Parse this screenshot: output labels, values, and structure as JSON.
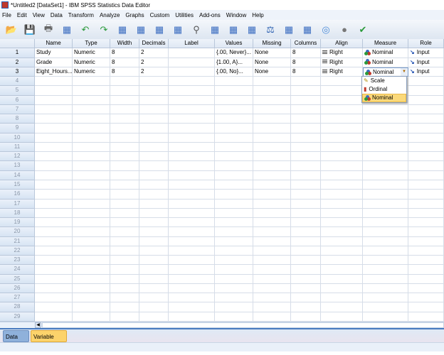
{
  "window": {
    "title": "*Untitled2 [DataSet1] - IBM SPSS Statistics Data Editor"
  },
  "menu": [
    "File",
    "Edit",
    "View",
    "Data",
    "Transform",
    "Analyze",
    "Graphs",
    "Custom",
    "Utilities",
    "Add-ons",
    "Window",
    "Help"
  ],
  "toolbar": [
    "open-icon",
    "save-icon",
    "print-icon",
    "recall-dialog-icon",
    "undo-icon",
    "redo-icon",
    "goto-case-icon",
    "goto-variable-icon",
    "variables-icon",
    "insert-variable-icon",
    "find-icon",
    "insert-cases-icon",
    "select-cases-icon",
    "split-file-icon",
    "weight-cases-icon",
    "value-labels-icon",
    "use-sets-icon",
    "show-all-variables-icon",
    "hide-icon",
    "spell-check-icon"
  ],
  "columns": [
    "Name",
    "Type",
    "Width",
    "Decimals",
    "Label",
    "Values",
    "Missing",
    "Columns",
    "Align",
    "Measure",
    "Role"
  ],
  "variables": [
    {
      "row": "1",
      "name": "Study",
      "type": "Numeric",
      "width": "8",
      "decimals": "2",
      "label": "",
      "values": "{.00, Never}...",
      "missing": "None",
      "columns": "8",
      "align": "Right",
      "measure": "Nominal",
      "role": "Input"
    },
    {
      "row": "2",
      "name": "Grade",
      "type": "Numeric",
      "width": "8",
      "decimals": "2",
      "label": "",
      "values": "{1.00, A}...",
      "missing": "None",
      "columns": "8",
      "align": "Right",
      "measure": "Nominal",
      "role": "Input"
    },
    {
      "row": "3",
      "name": "Eight_Hours...",
      "type": "Numeric",
      "width": "8",
      "decimals": "2",
      "label": "",
      "values": "{.00, No}...",
      "missing": "None",
      "columns": "8",
      "align": "Right",
      "measure": "Nominal",
      "role": "Input"
    }
  ],
  "empty_rows": [
    "4",
    "5",
    "6",
    "7",
    "8",
    "9",
    "10",
    "11",
    "12",
    "13",
    "14",
    "15",
    "16",
    "17",
    "18",
    "19",
    "20",
    "21",
    "22",
    "23",
    "24",
    "25",
    "26",
    "27",
    "28",
    "29"
  ],
  "measure_dropdown": {
    "selected": "Nominal",
    "options": [
      "Scale",
      "Ordinal",
      "Nominal"
    ]
  },
  "tabs": {
    "data_view": "Data View",
    "variable_view": "Variable View",
    "active": "Variable View"
  },
  "colors": {
    "active_tab": "#fcd36b",
    "selected_option": "#fbd97a",
    "header": "#dfe8f4"
  }
}
